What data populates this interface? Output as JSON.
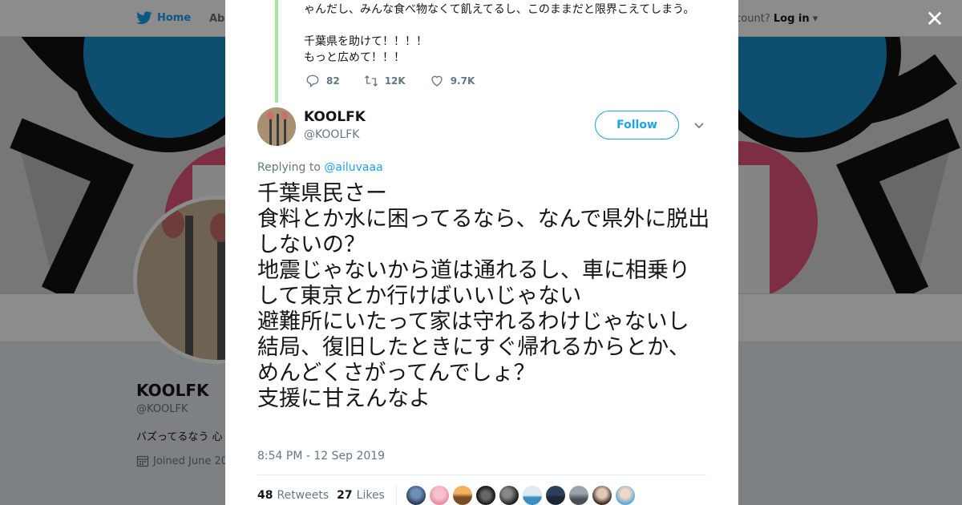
{
  "nav": {
    "home": "Home",
    "about": "Abo",
    "account_prompt": "ccount?",
    "login": "Log in"
  },
  "profile": {
    "name": "KOOLFK",
    "handle": "@KOOLFK",
    "bio": "バズってるなう 心",
    "joined": "Joined June 20"
  },
  "previous_tweet": {
    "lines": [
      "ゃんだし、みんな食べ物なくて飢えてるし、このままだと限界こえてしまう。",
      "",
      "千葉県を助けて！！！！",
      "もっと広めて！！！"
    ],
    "replies": "82",
    "retweets": "12K",
    "likes": "9.7K"
  },
  "tweet": {
    "author_name": "KOOLFK",
    "author_handle": "@KOOLFK",
    "follow_label": "Follow",
    "replying_to_label": "Replying to",
    "replying_to_handle": "@ailuvaaa",
    "lines": [
      "千葉県民さー",
      "食料とか水に困ってるなら、なんで県外に脱出しないの？",
      "地震じゃないから道は通れるし、車に相乗りして東京とか行けばいいじゃない",
      "避難所にいたって家は守れるわけじゃないし",
      "結局、復旧したときにすぐ帰れるからとか、めんどくさがってんでしょ？",
      "支援に甘えんなよ"
    ],
    "timestamp": "8:54 PM - 12 Sep 2019",
    "retweets_count": "48",
    "retweets_label": "Retweets",
    "likes_count": "27",
    "likes_label": "Likes"
  },
  "icons": {
    "brand": "twitter-bird-icon",
    "close": "close-icon",
    "reply": "reply-icon",
    "retweet": "retweet-icon",
    "like": "heart-icon",
    "caret": "chevron-down-icon",
    "calendar": "calendar-icon"
  },
  "colors": {
    "brand_blue": "#1da1f2",
    "thread_line": "#abe3a6",
    "text_primary": "#14171a",
    "text_secondary": "#657786"
  }
}
